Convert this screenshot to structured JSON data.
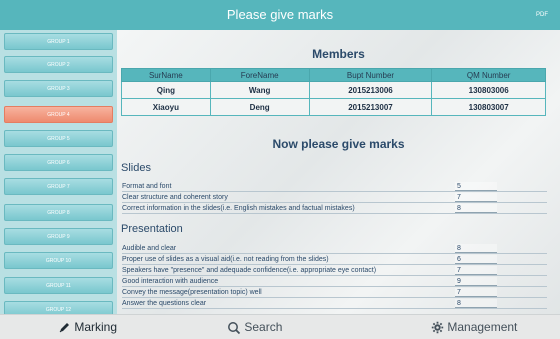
{
  "header": {
    "title": "Please give marks",
    "pdf_label": "PDF"
  },
  "sidebar": {
    "groups": [
      "GROUP 1",
      "GROUP 2",
      "GROUP 3",
      "GROUP 4",
      "GROUP 5",
      "GROUP 6",
      "GROUP 7",
      "GROUP 8",
      "GROUP 9",
      "GROUP 10",
      "GROUP 11",
      "GROUP 12"
    ],
    "active_group": "GROUP 4"
  },
  "members": {
    "title": "Members",
    "columns": [
      "SurName",
      "ForeName",
      "Bupt Number",
      "QM Number"
    ],
    "rows": [
      [
        "Qing",
        "Wang",
        "2015213006",
        "130803006"
      ],
      [
        "Xiaoyu",
        "Deng",
        "2015213007",
        "130803007"
      ]
    ]
  },
  "marks_title": "Now please give marks",
  "slides": {
    "title": "Slides",
    "criteria": [
      {
        "label": "Format and font",
        "score": "5"
      },
      {
        "label": "Clear structure and coherent story",
        "score": "7"
      },
      {
        "label": "Correct information in the slides(i.e. English mistakes and factual mistakes)",
        "score": "8"
      }
    ]
  },
  "presentation": {
    "title": "Presentation",
    "criteria": [
      {
        "label": "Audible and clear",
        "score": "8"
      },
      {
        "label": "Proper use  of slides as a visual aid(i.e. not reading from the slides)",
        "score": "6"
      },
      {
        "label": "Speakers have \"presence\" and adequade confidence(i.e. appropriate eye contact)",
        "score": "7"
      },
      {
        "label": "Good interaction with audience",
        "score": "9"
      },
      {
        "label": "Convey the message(presentation topic) well",
        "score": "7"
      },
      {
        "label": "Answer the questions clear",
        "score": "8"
      }
    ]
  },
  "bottom_nav": {
    "marking": "Marking",
    "search": "Search",
    "management": "Management"
  },
  "colors": {
    "accent": "#56b6bc",
    "active": "#ee8a6e",
    "text": "#2b4a6a"
  }
}
